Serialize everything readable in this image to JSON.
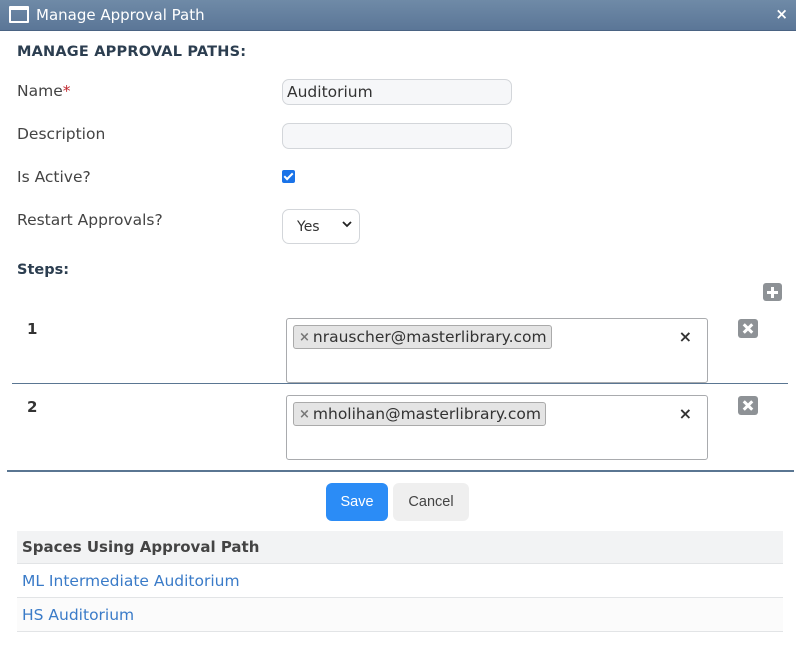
{
  "dialog": {
    "title": "Manage Approval Path",
    "close_glyph": "×"
  },
  "form": {
    "section_title": "MANAGE APPROVAL PATHS:",
    "name_label": "Name",
    "required_mark": "*",
    "name_value": "Auditorium",
    "description_label": "Description",
    "description_value": "",
    "is_active_label": "Is Active?",
    "is_active_checked": true,
    "restart_label": "Restart Approvals?",
    "restart_value": "Yes"
  },
  "steps": {
    "title": "Steps:",
    "items": [
      {
        "number": "1",
        "approver": "nrauscher@masterlibrary.com"
      },
      {
        "number": "2",
        "approver": "mholihan@masterlibrary.com"
      }
    ],
    "tag_remove_glyph": "×",
    "clear_glyph": "×"
  },
  "actions": {
    "save_label": "Save",
    "cancel_label": "Cancel"
  },
  "spaces": {
    "header": "Spaces Using Approval Path",
    "rows": [
      "ML Intermediate Auditorium",
      "HS Auditorium"
    ]
  },
  "colors": {
    "titlebar": "#5b7697",
    "primary": "#2b8cf6",
    "link": "#3a7bc8",
    "required": "#c0262d"
  }
}
